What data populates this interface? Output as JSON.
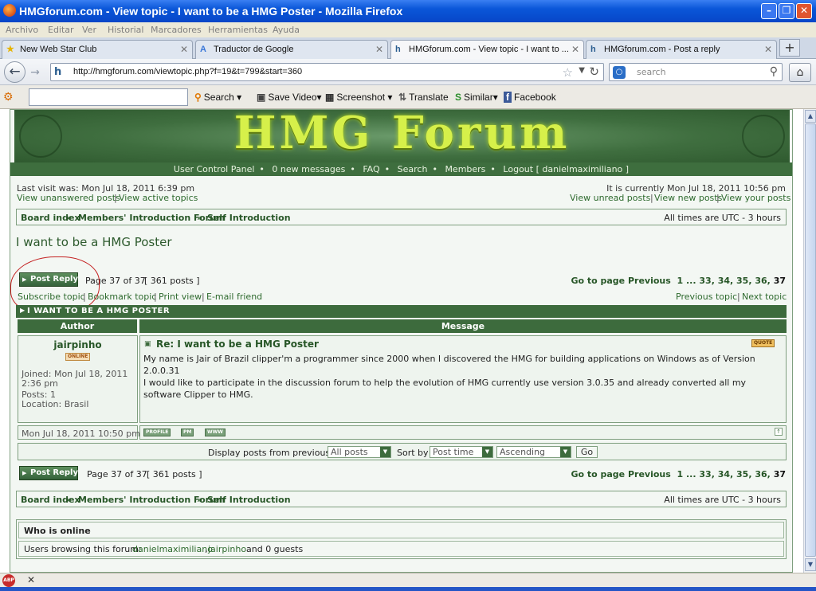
{
  "window": {
    "title": "HMGforum.com - View topic - I want to be a HMG Poster - Mozilla Firefox"
  },
  "menu": [
    "Archivo",
    "Editar",
    "Ver",
    "Historial",
    "Marcadores",
    "Herramientas",
    "Ayuda"
  ],
  "tabs": [
    {
      "label": "New Web Star Club"
    },
    {
      "label": "Traductor de Google"
    },
    {
      "label": "HMGforum.com - View topic - I want to ..."
    },
    {
      "label": "HMGforum.com - Post a reply"
    }
  ],
  "nav": {
    "url": "http://hmgforum.com/viewtopic.php?f=19&t=799&start=360",
    "search_placeholder": "search"
  },
  "toolbar2": {
    "search": "Search",
    "save_video": "Save Video",
    "screenshot": "Screenshot",
    "translate": "Translate",
    "similar": "Similar",
    "facebook": "Facebook"
  },
  "forum": {
    "logo": "HMG Forum",
    "nav_links": [
      "User Control Panel",
      "0 new messages",
      "FAQ",
      "Search",
      "Members",
      "Logout [ danielmaximiliano ]"
    ],
    "last_visit": "Last visit was: Mon Jul 18, 2011 6:39 pm",
    "current_time": "It is currently Mon Jul 18, 2011 10:56 pm",
    "left_links": [
      "View unanswered posts",
      "View active topics"
    ],
    "right_links": [
      "View unread posts",
      "View new posts",
      "View your posts"
    ],
    "breadcrumb": [
      "Board index",
      "Members' Introduction Forum",
      "Self Introduction"
    ],
    "timezone": "All times are UTC - 3 hours",
    "topic_title": "I want to be a HMG Poster",
    "post_reply": "Post Reply",
    "page_info": "Page 37 of 37",
    "post_count": "[ 361 posts ]",
    "goto_label": "Go to page",
    "goto_prev": "Previous",
    "goto_pages": [
      "1",
      "...",
      "33",
      "34",
      "35",
      "36",
      "37"
    ],
    "topic_actions": [
      "Subscribe topic",
      "Bookmark topic",
      "Print view",
      "E-mail friend"
    ],
    "topic_nav": [
      "Previous topic",
      "Next topic"
    ],
    "topic_header": "I WANT TO BE A HMG POSTER",
    "col_author": "Author",
    "col_message": "Message",
    "post": {
      "author": "jairpinho",
      "online": "ONLINE",
      "joined": "Joined: Mon Jul 18, 2011 2:36 pm",
      "posts": "Posts: 1",
      "location": "Location: Brasil",
      "subject": "Re: I want to be a HMG Poster",
      "quote": "QUOTE",
      "body_1": "My name is Jair of Brazil clipper'm a programmer since 2000 when I discovered the HMG for building applications on Windows as of Version 2.0.0.31",
      "body_2": "I would like to participate in the discussion forum to help the evolution of HMG currently use version 3.0.35 and already converted all my software Clipper to HMG.",
      "date": "Mon Jul 18, 2011 10:50 pm",
      "btn_profile": "PROFILE",
      "btn_pm": "PM",
      "btn_www": "WWW"
    },
    "display_label": "Display posts from previous:",
    "display_value": "All posts",
    "sort_label": "Sort by",
    "sort_value": "Post time",
    "order_value": "Ascending",
    "go": "Go",
    "who_online_title": "Who is online",
    "users_label": "Users browsing this forum:",
    "users": [
      "danielmaximiliano",
      "jairpinho"
    ],
    "users_suffix": "and 0 guests"
  }
}
